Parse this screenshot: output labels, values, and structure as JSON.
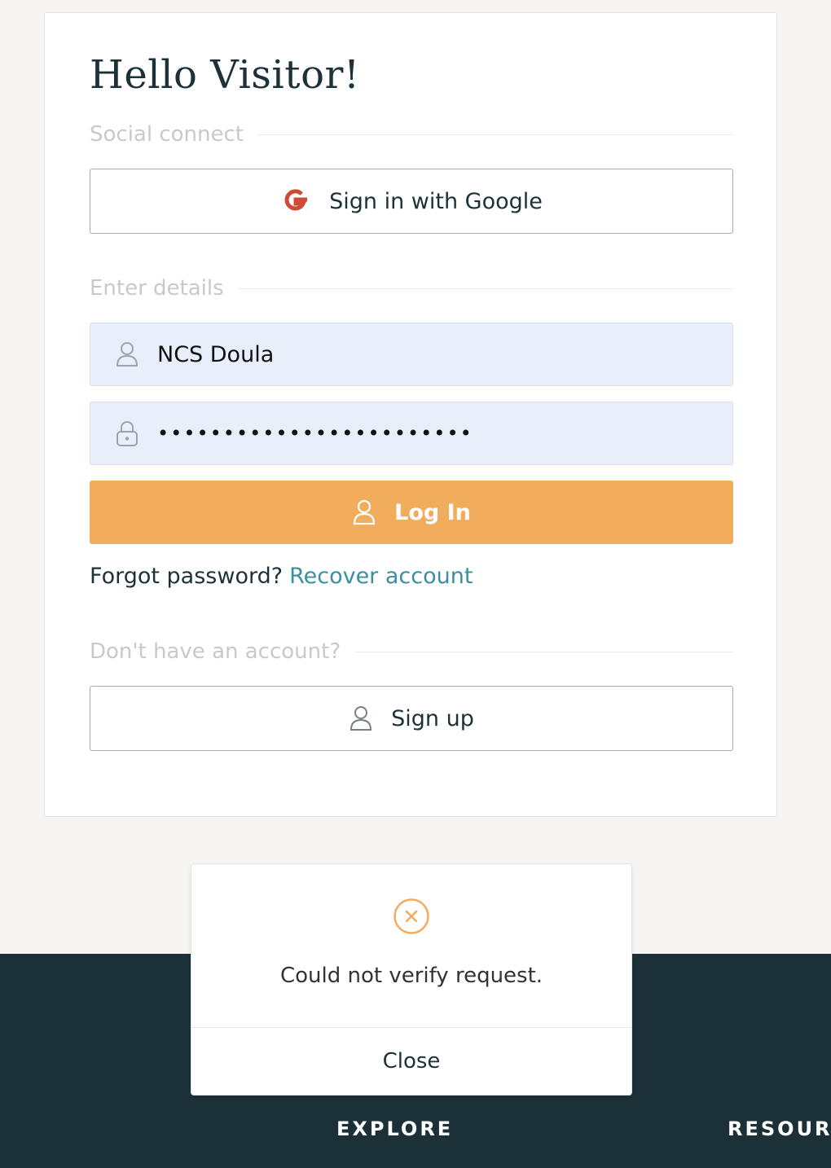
{
  "login": {
    "title": "Hello Visitor!",
    "social_section_label": "Social connect",
    "google_button_label": "Sign in with Google",
    "details_section_label": "Enter details",
    "username_value": "NCS Doula",
    "password_value": "••••••••••••••••••••••••",
    "login_button_label": "Log In",
    "forgot_text": "Forgot password?",
    "recover_link": "Recover account",
    "no_account_label": "Don't have an account?",
    "signup_button_label": "Sign up"
  },
  "modal": {
    "message": "Could not verify request.",
    "close_label": "Close",
    "icon": "x-circle-icon"
  },
  "footer": {
    "nav": [
      "EXPLORE",
      "RESOURC"
    ]
  },
  "colors": {
    "accent": "#f2ad5c",
    "link": "#3a8fa0",
    "footer_bg": "#1b3137",
    "field_bg": "#e8effb",
    "google_red": "#cf4b36"
  }
}
